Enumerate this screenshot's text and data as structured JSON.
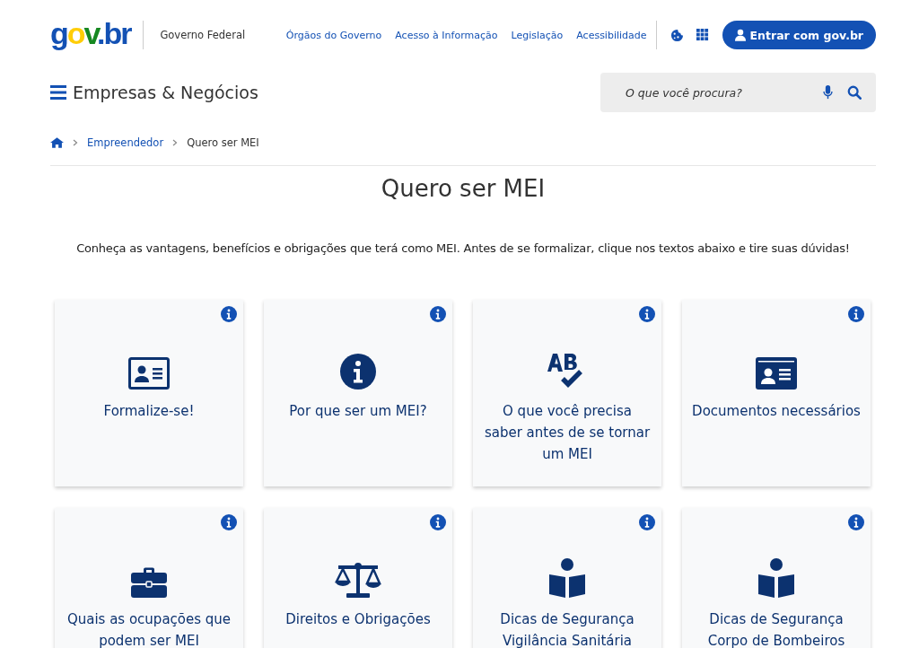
{
  "header": {
    "logo": "gov.br",
    "org": "Governo Federal",
    "links": [
      "Órgãos do Governo",
      "Acesso à Informação",
      "Legislação",
      "Acessibilidade"
    ],
    "login_button": "Entrar com gov.br"
  },
  "site": {
    "title": "Empresas & Negócios",
    "search": {
      "placeholder": "O que você procura?"
    }
  },
  "breadcrumb": [
    {
      "label": "Empreendedor",
      "current": false
    },
    {
      "label": "Quero ser MEI",
      "current": true
    }
  ],
  "page": {
    "title": "Quero ser MEI",
    "intro": "Conheça as vantagens, benefícios e obrigações que terá como MEI. Antes de se formalizar, clique nos textos abaixo e tire suas dúvidas!"
  },
  "cards": [
    {
      "kind": "id-card",
      "label": "Formalize-se!"
    },
    {
      "kind": "info",
      "label": "Por que ser um MEI?"
    },
    {
      "kind": "spellcheck",
      "label": "O que você precisa saber antes de se tornar um MEI"
    },
    {
      "kind": "id-card-wide",
      "label": "Documentos necessários"
    },
    {
      "kind": "briefcase",
      "label": "Quais as ocupações que podem ser MEI"
    },
    {
      "kind": "scale",
      "label": "Direitos e Obrigações"
    },
    {
      "kind": "reader",
      "label": "Dicas de Segurança Vigilância Sanitária"
    },
    {
      "kind": "reader",
      "label": "Dicas de Segurança Corpo de Bombeiros"
    }
  ]
}
